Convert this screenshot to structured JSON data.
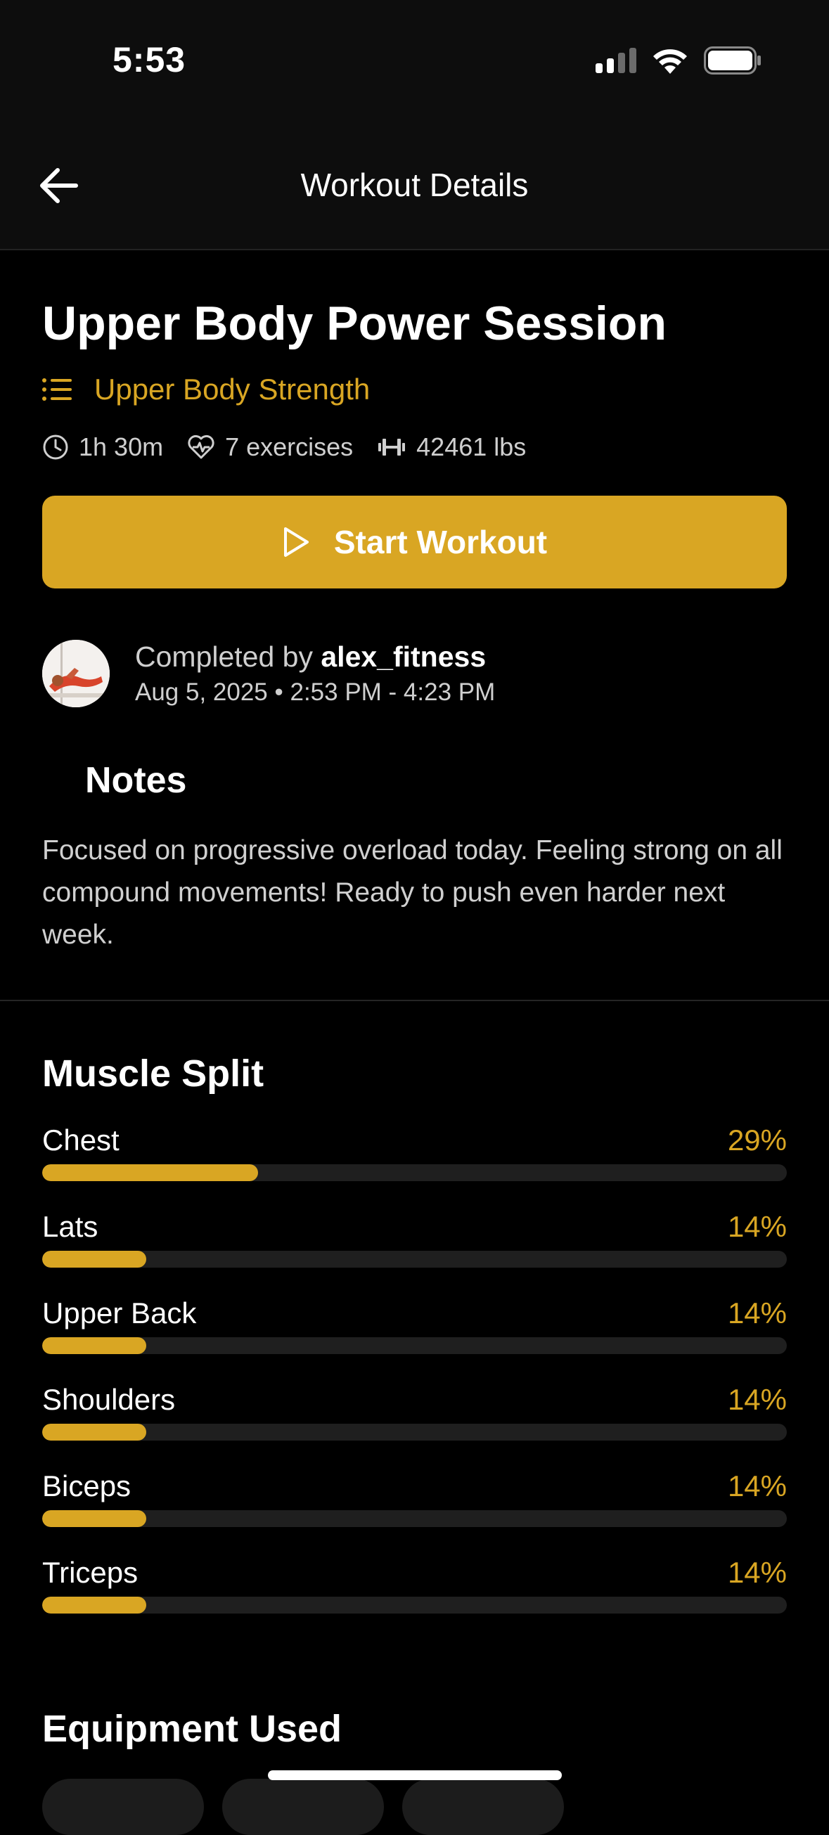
{
  "status": {
    "time": "5:53",
    "icons": [
      "signal-icon",
      "wifi-icon",
      "battery-icon"
    ]
  },
  "nav": {
    "title": "Workout Details",
    "back_icon": "arrow-left-icon"
  },
  "workout": {
    "title": "Upper Body Power Session",
    "category": "Upper Body Strength",
    "duration": "1h 30m",
    "exercises": "7 exercises",
    "volume": "42461 lbs"
  },
  "start_button": {
    "label": "Start Workout"
  },
  "completion": {
    "prefix": "Completed by",
    "user": "alex_fitness",
    "datetime": "Aug 5, 2025 • 2:53 PM - 4:23 PM"
  },
  "notes": {
    "title": "Notes",
    "text": "Focused on progressive overload today. Feeling strong on all compound movements! Ready to push even harder next week."
  },
  "muscle_split": {
    "title": "Muscle Split",
    "items": [
      {
        "name": "Chest",
        "percent_label": "29%",
        "percent": 29
      },
      {
        "name": "Lats",
        "percent_label": "14%",
        "percent": 14
      },
      {
        "name": "Upper Back",
        "percent_label": "14%",
        "percent": 14
      },
      {
        "name": "Shoulders",
        "percent_label": "14%",
        "percent": 14
      },
      {
        "name": "Biceps",
        "percent_label": "14%",
        "percent": 14
      },
      {
        "name": "Triceps",
        "percent_label": "14%",
        "percent": 14
      }
    ]
  },
  "equipment": {
    "title": "Equipment Used"
  },
  "colors": {
    "accent": "#D9A623",
    "background": "#000000",
    "track": "#1F1F1F"
  }
}
